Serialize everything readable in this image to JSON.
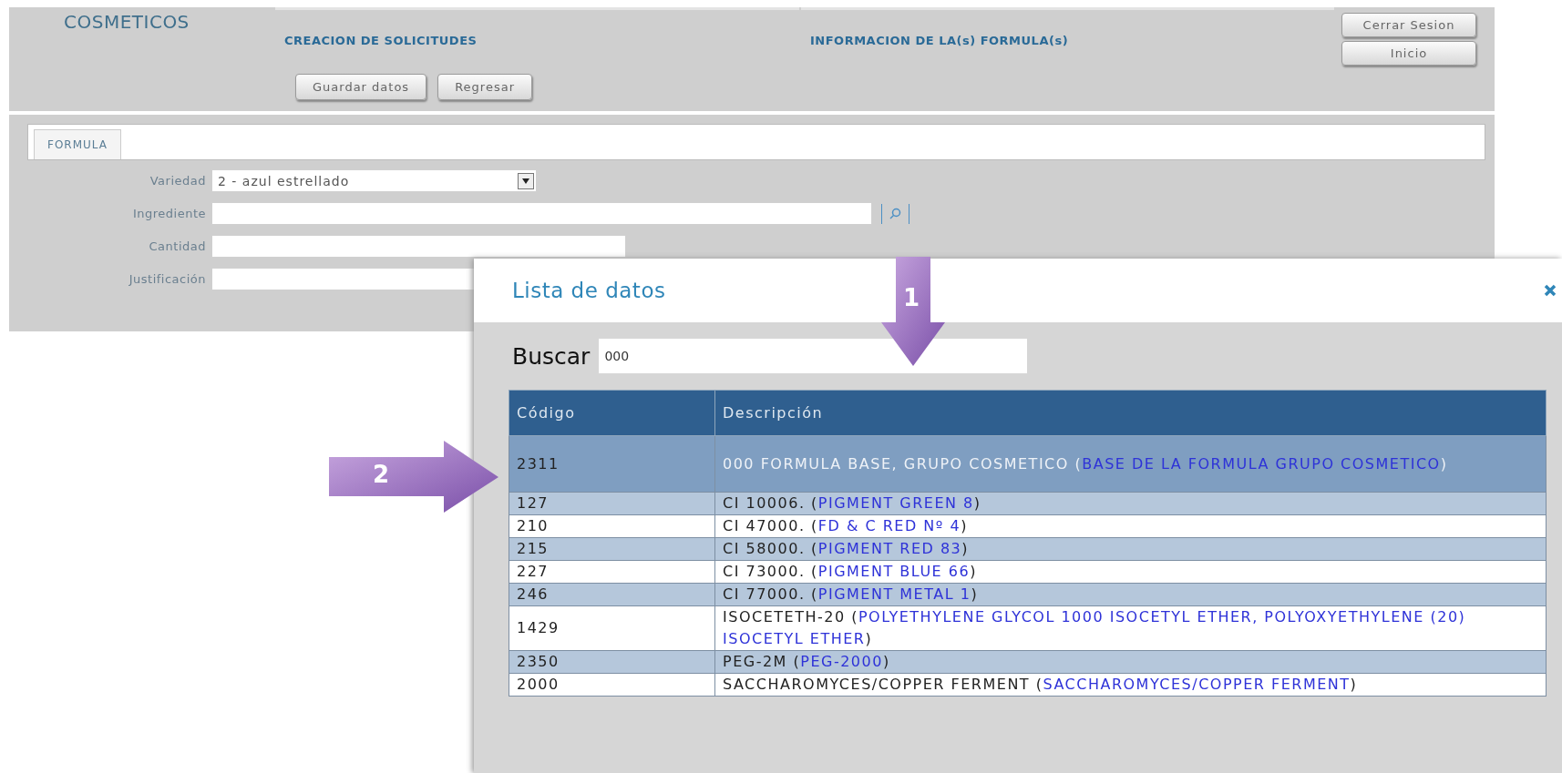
{
  "header": {
    "app_title": "COSMETICOS",
    "nav": [
      {
        "label": "CREACION DE SOLICITUDES"
      },
      {
        "label": "INFORMACION DE LA(s) FORMULA(s)"
      }
    ],
    "actions": [
      "Guardar datos",
      "Regresar"
    ],
    "session_buttons": [
      "Cerrar Sesion",
      "Inicio"
    ]
  },
  "form": {
    "tab": "FORMULA",
    "fields": [
      {
        "kind": "select",
        "label": "Variedad",
        "value": "2 - azul estrellado"
      },
      {
        "kind": "lookup",
        "label": "Ingrediente"
      },
      {
        "kind": "short",
        "label": "Cantidad"
      },
      {
        "kind": "text",
        "label": "Justificación"
      }
    ]
  },
  "dialog": {
    "title": "Lista de datos",
    "search_label": "Buscar",
    "search_value": "000",
    "columns": [
      "Código",
      "Descripción"
    ],
    "rows": [
      {
        "code": "2311",
        "selected": true,
        "description": [
          {
            "kind": "plain",
            "text": "000 FORMULA BASE, GRUPO COSMETICO ("
          },
          {
            "kind": "synonym",
            "text": "BASE DE LA FORMULA GRUPO COSMETICO"
          },
          {
            "kind": "plain",
            "text": ")"
          }
        ]
      },
      {
        "code": "127",
        "selected": false,
        "description": [
          {
            "kind": "plain",
            "text": "CI 10006. ("
          },
          {
            "kind": "synonym",
            "text": "PIGMENT GREEN 8"
          },
          {
            "kind": "plain",
            "text": ")"
          }
        ]
      },
      {
        "code": "210",
        "selected": false,
        "description": [
          {
            "kind": "plain",
            "text": "CI 47000. ("
          },
          {
            "kind": "synonym",
            "text": "FD & C RED Nº 4"
          },
          {
            "kind": "plain",
            "text": ")"
          }
        ]
      },
      {
        "code": "215",
        "selected": false,
        "description": [
          {
            "kind": "plain",
            "text": "CI 58000. ("
          },
          {
            "kind": "synonym",
            "text": "PIGMENT RED 83"
          },
          {
            "kind": "plain",
            "text": ")"
          }
        ]
      },
      {
        "code": "227",
        "selected": false,
        "description": [
          {
            "kind": "plain",
            "text": "CI 73000. ("
          },
          {
            "kind": "synonym",
            "text": "PIGMENT BLUE 66"
          },
          {
            "kind": "plain",
            "text": ")"
          }
        ]
      },
      {
        "code": "246",
        "selected": false,
        "description": [
          {
            "kind": "plain",
            "text": "CI 77000. ("
          },
          {
            "kind": "synonym",
            "text": "PIGMENT METAL 1"
          },
          {
            "kind": "plain",
            "text": ")"
          }
        ]
      },
      {
        "code": "1429",
        "selected": false,
        "description": [
          {
            "kind": "plain",
            "text": "ISOCETETH-20 ("
          },
          {
            "kind": "synonym",
            "text": "POLYETHYLENE GLYCOL 1000 ISOCETYL ETHER, POLYOXYETHYLENE (20) ISOCETYL ETHER"
          },
          {
            "kind": "plain",
            "text": ")"
          }
        ]
      },
      {
        "code": "2350",
        "selected": false,
        "description": [
          {
            "kind": "plain",
            "text": "PEG-2M ("
          },
          {
            "kind": "synonym",
            "text": "PEG-2000"
          },
          {
            "kind": "plain",
            "text": ")"
          }
        ]
      },
      {
        "code": "2000",
        "selected": false,
        "description": [
          {
            "kind": "plain",
            "text": "SACCHAROMYCES/COPPER FERMENT ("
          },
          {
            "kind": "synonym",
            "text": "SACCHAROMYCES/COPPER FERMENT"
          },
          {
            "kind": "plain",
            "text": ")"
          }
        ]
      }
    ]
  },
  "callouts": [
    {
      "number": "1",
      "kind": "down"
    },
    {
      "number": "2",
      "kind": "right"
    }
  ]
}
